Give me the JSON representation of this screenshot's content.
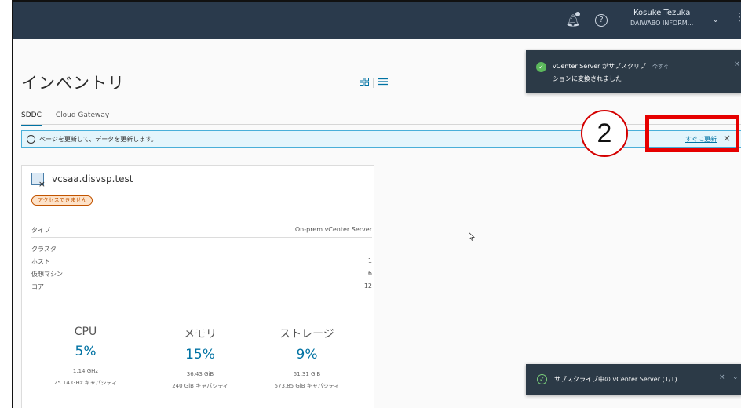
{
  "header": {
    "user_name": "Kosuke Tezuka",
    "org_name": "DAIWABO INFORM...",
    "icons": [
      "bell-icon",
      "help-icon",
      "chevron-down-icon",
      "more-icon"
    ]
  },
  "page": {
    "title": "インベントリ"
  },
  "view_toggle": {
    "icons": [
      "grid-view-icon",
      "list-view-icon"
    ]
  },
  "tabs": [
    {
      "label": "SDDC",
      "active": true
    },
    {
      "label": "Cloud Gateway",
      "active": false
    }
  ],
  "alert": {
    "message": "ページを更新して、データを更新します。",
    "refresh_label": "すぐに更新",
    "close_label": "×"
  },
  "annotation": {
    "step_number": "2",
    "highlight_color": "#e60000"
  },
  "card": {
    "title": "vcsaa.disvsp.test",
    "badge": "アクセスできません",
    "type_label": "タイプ",
    "type_value": "On-prem vCenter Server",
    "stats": [
      {
        "label": "クラスタ",
        "value": "1"
      },
      {
        "label": "ホスト",
        "value": "1"
      },
      {
        "label": "仮想マシン",
        "value": "6"
      },
      {
        "label": "コア",
        "value": "12"
      }
    ],
    "metrics": [
      {
        "label": "CPU",
        "percent": "5%",
        "used": "1.14 GHz",
        "capacity": "25.14 GHz キャパシティ"
      },
      {
        "label": "メモリ",
        "percent": "15%",
        "used": "36.43 GiB",
        "capacity": "240 GiB キャパシティ"
      },
      {
        "label": "ストレージ",
        "percent": "9%",
        "used": "51.31 GiB",
        "capacity": "573.85 GiB キャパシティ"
      }
    ]
  },
  "toasts": {
    "top": {
      "line1": "vCenter Server がサブスクリプ",
      "time": "今すぐ",
      "line2": "ションに変換されました",
      "close": "×"
    },
    "bottom": {
      "message": "サブスクライブ中の vCenter Server (1/1)",
      "close": "×",
      "chevron": "⌄"
    }
  },
  "colors": {
    "accent": "#0072a3",
    "header_bg": "#2a3a4c",
    "toast_bg": "#2c3a47",
    "success": "#5cb85c",
    "badge": "#c25400"
  }
}
